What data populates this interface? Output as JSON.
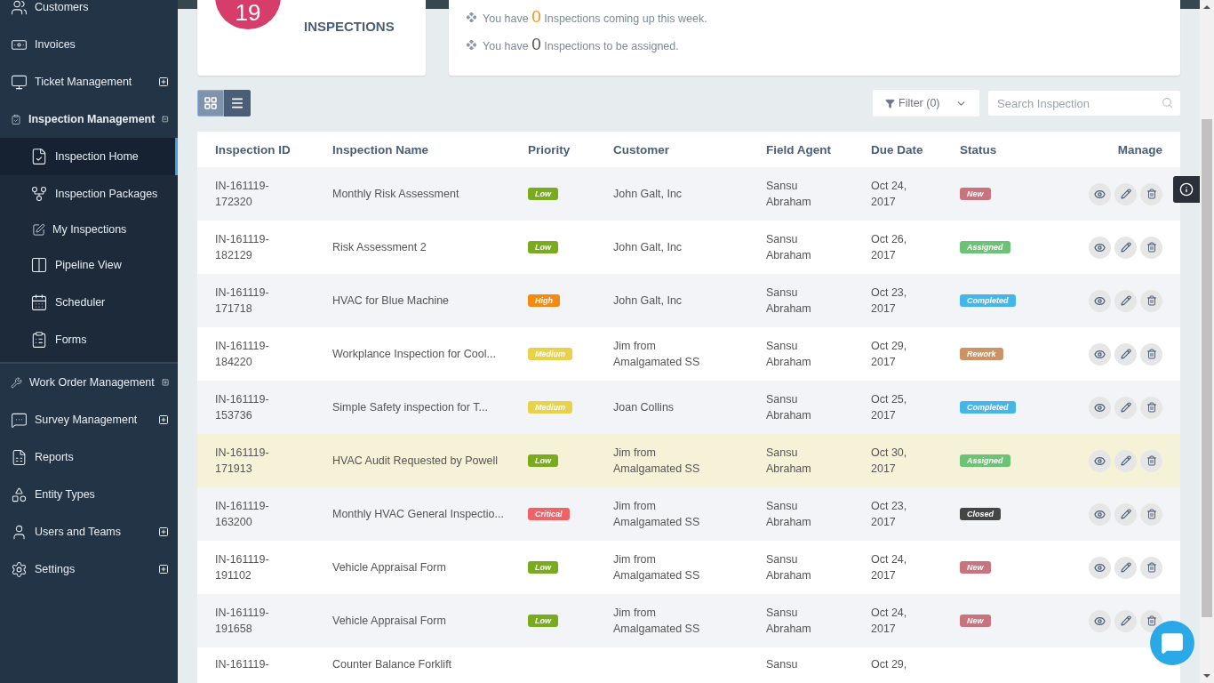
{
  "sidebar": {
    "items": [
      {
        "label": "Customers"
      },
      {
        "label": "Invoices"
      },
      {
        "label": "Ticket Management",
        "expanded": false
      },
      {
        "label": "Inspection Management",
        "expanded": true,
        "children": [
          {
            "label": "Inspection Home",
            "selected": true
          },
          {
            "label": "Inspection Packages",
            "selected": false
          },
          {
            "label": "My Inspections",
            "selected": false
          },
          {
            "label": "Pipeline View",
            "selected": false
          },
          {
            "label": "Scheduler",
            "selected": false
          },
          {
            "label": "Forms",
            "selected": false
          }
        ]
      },
      {
        "label": "Work Order Management",
        "expanded": false
      },
      {
        "label": "Survey Management",
        "expanded": false
      },
      {
        "label": "Reports"
      },
      {
        "label": "Entity Types"
      },
      {
        "label": "Users and Teams",
        "expanded": false
      },
      {
        "label": "Settings",
        "expanded": false
      }
    ]
  },
  "summary": {
    "count": "19",
    "label": "INSPECTIONS"
  },
  "notes": [
    {
      "before": "You have",
      "count": "0",
      "after": "Inspections coming up this week.",
      "highlight": true
    },
    {
      "before": "You have",
      "count": "0",
      "after": "Inspections to be assigned.",
      "highlight": false
    }
  ],
  "views": [
    {
      "selected": true
    },
    {
      "selected": false
    }
  ],
  "filter": {
    "label": "Filter (0)"
  },
  "search": {
    "placeholder": "Search Inspection"
  },
  "table": {
    "columns": [
      "Inspection ID",
      "Inspection Name",
      "Priority",
      "Customer",
      "Field Agent",
      "Due Date",
      "Status",
      "Manage"
    ],
    "rows": [
      {
        "id": "IN-161119-172320",
        "name": "Monthly Risk Assessment",
        "priority": {
          "text": "Low",
          "color": "#7aab1e"
        },
        "customer": "John Galt, Inc",
        "agent": "Sansu Abraham",
        "due": "Oct 24, 2017",
        "status": {
          "text": "New",
          "color": "#c9737f"
        },
        "selected": false
      },
      {
        "id": "IN-161119-182129",
        "name": "Risk Assessment 2",
        "priority": {
          "text": "Low",
          "color": "#7aab1e"
        },
        "customer": "John Galt, Inc",
        "agent": "Sansu Abraham",
        "due": "Oct 26, 2017",
        "status": {
          "text": "Assigned",
          "color": "#6cc375"
        },
        "selected": false
      },
      {
        "id": "IN-161119-171718",
        "name": "HVAC for Blue Machine",
        "priority": {
          "text": "High",
          "color": "#f58a0f"
        },
        "customer": "John Galt, Inc",
        "agent": "Sansu Abraham",
        "due": "Oct 23, 2017",
        "status": {
          "text": "Completed",
          "color": "#45b6ea"
        },
        "selected": false
      },
      {
        "id": "IN-161119-184220",
        "name": "Workplance Inspection for Cool...",
        "priority": {
          "text": "Medium",
          "color": "#e8d24a"
        },
        "customer": "Jim from Amalgamated SS",
        "agent": "Sansu Abraham",
        "due": "Oct 29, 2017",
        "status": {
          "text": "Rework",
          "color": "#cc9366"
        },
        "selected": false
      },
      {
        "id": "IN-161119-153736",
        "name": "Simple Safety inspection for T...",
        "priority": {
          "text": "Medium",
          "color": "#e8d24a"
        },
        "customer": "Joan Collins",
        "agent": "Sansu Abraham",
        "due": "Oct 25, 2017",
        "status": {
          "text": "Completed",
          "color": "#45b6ea"
        },
        "selected": false
      },
      {
        "id": "IN-161119-171913",
        "name": "HVAC Audit Requested by Powell",
        "priority": {
          "text": "Low",
          "color": "#7aab1e"
        },
        "customer": "Jim from Amalgamated SS",
        "agent": "Sansu Abraham",
        "due": "Oct 30, 2017",
        "status": {
          "text": "Assigned",
          "color": "#6cc375"
        },
        "selected": true
      },
      {
        "id": "IN-161119-163200",
        "name": "Monthly HVAC General Inspectio...",
        "priority": {
          "text": "Critical",
          "color": "#ef6266"
        },
        "customer": "Jim from Amalgamated SS",
        "agent": "Sansu Abraham",
        "due": "Oct 23, 2017",
        "status": {
          "text": "Closed",
          "color": "#454545"
        },
        "selected": false
      },
      {
        "id": "IN-161119-191102",
        "name": "Vehicle Appraisal Form",
        "priority": {
          "text": "Low",
          "color": "#7aab1e"
        },
        "customer": "Jim from Amalgamated SS",
        "agent": "Sansu Abraham",
        "due": "Oct 24, 2017",
        "status": {
          "text": "New",
          "color": "#c9737f"
        },
        "selected": false
      },
      {
        "id": "IN-161119-191658",
        "name": "Vehicle Appraisal Form",
        "priority": {
          "text": "Low",
          "color": "#7aab1e"
        },
        "customer": "Jim from Amalgamated SS",
        "agent": "Sansu Abraham",
        "due": "Oct 24, 2017",
        "status": {
          "text": "New",
          "color": "#c9737f"
        },
        "selected": false
      },
      {
        "id": "IN-161119-",
        "name": "Counter Balance Forklift",
        "agent": "Sansu",
        "due": "Oct 29,",
        "selected": false
      }
    ]
  }
}
